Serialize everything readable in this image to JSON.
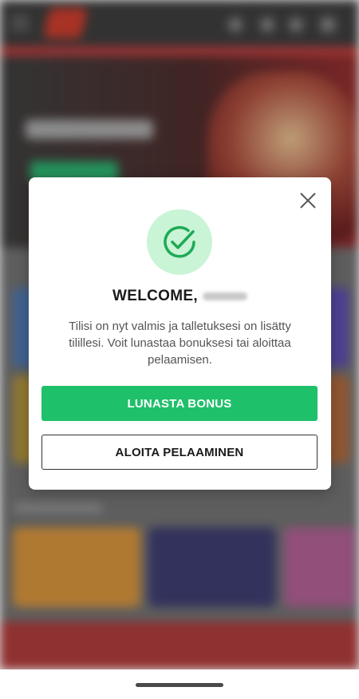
{
  "modal": {
    "welcome_prefix": "WELCOME,",
    "message": "Tilisi on nyt valmis ja talletuksesi on lisätty tilillesi. Voit lunastaa bonuksesi tai aloittaa pelaamisen.",
    "primary_button": "LUNASTA BONUS",
    "secondary_button": "ALOITA PELAAMINEN",
    "icons": {
      "close": "close-icon",
      "success": "check-circle-icon"
    }
  },
  "colors": {
    "accent_green": "#1fc06a",
    "check_bg": "#c9f4d6",
    "check_stroke": "#1faa55",
    "brand_red": "#b33b3b"
  }
}
